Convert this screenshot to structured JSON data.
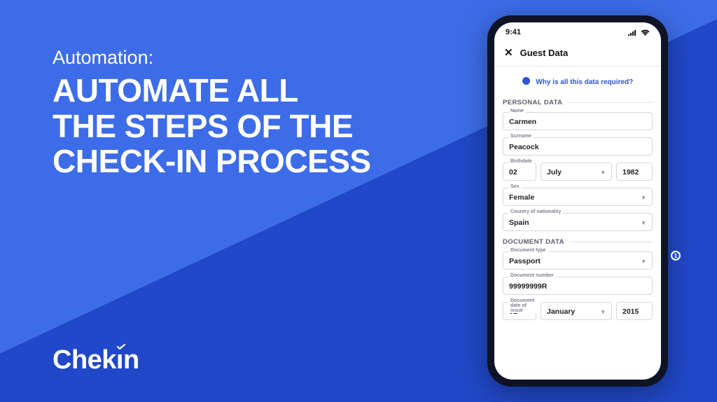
{
  "marketing": {
    "eyebrow": "Automation:",
    "headline_l1": "AUTOMATE ALL",
    "headline_l2": "THE STEPS OF THE",
    "headline_l3": "CHECK-IN PROCESS",
    "logo_text": "Chekin"
  },
  "phone": {
    "status_time": "9:41",
    "header_title": "Guest Data",
    "info_link": "Why is all this data required?",
    "side_badge": "1",
    "sections": {
      "personal": {
        "label": "PERSONAL DATA",
        "name": {
          "label": "Name",
          "value": "Carmen"
        },
        "surname": {
          "label": "Surname",
          "value": "Peacock"
        },
        "birthdate": {
          "label": "Birthdate",
          "day": "02",
          "month": "July",
          "year": "1982"
        },
        "sex": {
          "label": "Sex",
          "value": "Female"
        },
        "nationality": {
          "label": "Country of nationality",
          "value": "Spain"
        }
      },
      "document": {
        "label": "DOCUMENT DATA",
        "type": {
          "label": "Document type",
          "value": "Passport"
        },
        "number": {
          "label": "Document number",
          "value": "99999999R"
        },
        "issue": {
          "label": "Document date of issue",
          "day": "01",
          "month": "January",
          "year": "2015"
        }
      }
    }
  }
}
